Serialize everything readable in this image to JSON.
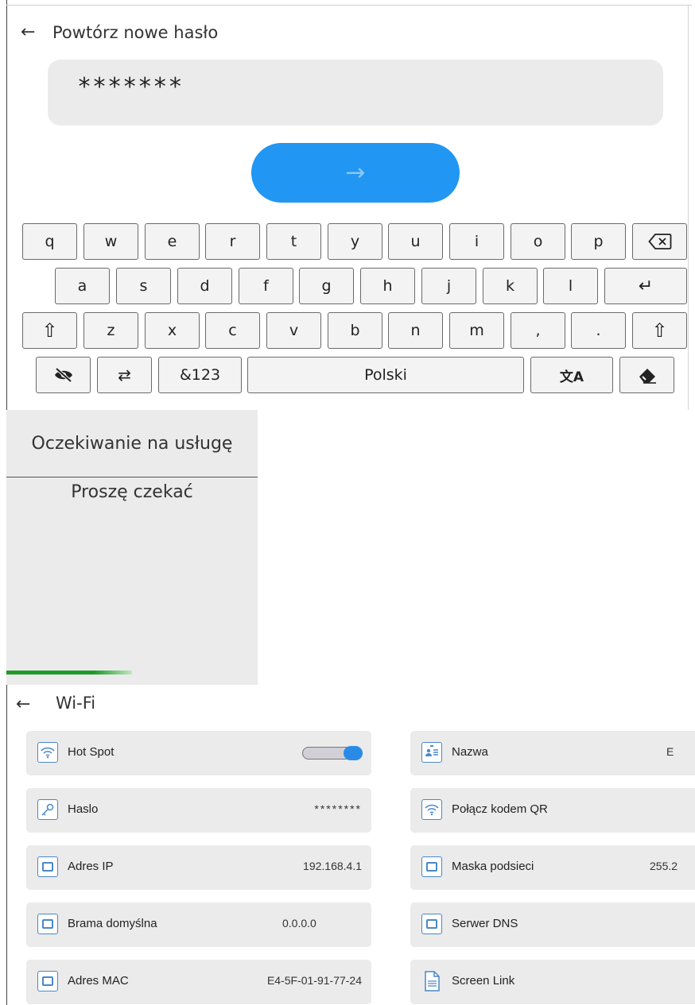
{
  "password_screen": {
    "back_glyph": "←",
    "title": "Powtórz nowe hasło",
    "password_value": "*******",
    "confirm_glyph": "→"
  },
  "keyboard": {
    "row1": [
      "q",
      "w",
      "e",
      "r",
      "t",
      "y",
      "u",
      "i",
      "o",
      "p"
    ],
    "row2": [
      "a",
      "s",
      "d",
      "f",
      "g",
      "h",
      "j",
      "k",
      "l"
    ],
    "row3": [
      "z",
      "x",
      "c",
      "v",
      "b",
      "n",
      "m",
      ",",
      "."
    ],
    "backspace_icon": "backspace-icon",
    "enter_glyph": "↵",
    "shift_glyph": "⇧",
    "switch_glyph": "⇄",
    "symbols_label": "&123",
    "space_label": "Polski",
    "translate_glyph": "文A",
    "hide_icon": "eye-off-icon",
    "clear_icon": "eraser-icon"
  },
  "waiting_dialog": {
    "title": "Oczekiwanie na usługę",
    "message": "Proszę czekać",
    "progress": 0.5
  },
  "wifi": {
    "back_glyph": "←",
    "title": "Wi-Fi",
    "left_tiles": [
      {
        "label": "Hot Spot",
        "value": "",
        "icon": "wifi-icon"
      },
      {
        "label": "Haslo",
        "value": "********",
        "icon": "key-icon"
      },
      {
        "label": "Adres IP",
        "value": "192.168.4.1",
        "icon": "network-icon"
      },
      {
        "label": "Brama domyślna",
        "value": "0.0.0.0",
        "icon": "network-icon"
      },
      {
        "label": "Adres MAC",
        "value": "E4-5F-01-91-77-24",
        "icon": "network-icon"
      }
    ],
    "right_tiles": [
      {
        "label": "Nazwa",
        "value": "E",
        "icon": "id-card-icon"
      },
      {
        "label": "Połącz kodem QR",
        "value": "",
        "icon": "wifi-icon"
      },
      {
        "label": "Maska podsieci",
        "value": "255.2",
        "icon": "network-icon"
      },
      {
        "label": "Serwer DNS",
        "value": "",
        "icon": "network-icon"
      },
      {
        "label": "Screen Link",
        "value": "",
        "icon": "document-icon"
      }
    ],
    "hotspot_enabled": true
  }
}
